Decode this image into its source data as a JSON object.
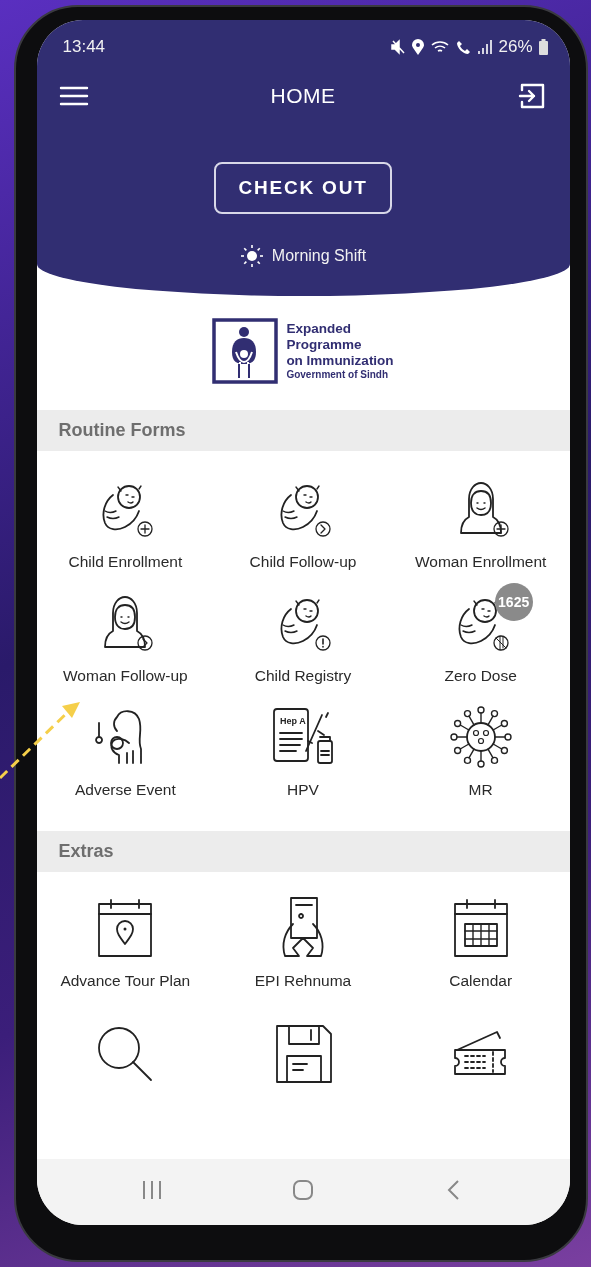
{
  "status_bar": {
    "time": "13:44",
    "battery": "26%"
  },
  "app_bar": {
    "title": "HOME"
  },
  "check_out_button": {
    "label": "CHECK OUT"
  },
  "shift": {
    "label": "Morning Shift"
  },
  "logo": {
    "lines": [
      "Expanded",
      "Programme",
      "on Immunization",
      "Government of Sindh"
    ]
  },
  "sections": [
    {
      "title": "Routine Forms",
      "tiles": [
        {
          "kind": "baby-plus",
          "label": "Child Enrollment"
        },
        {
          "kind": "baby-next",
          "label": "Child Follow-up"
        },
        {
          "kind": "woman-plus",
          "label": "Woman Enrollment"
        },
        {
          "kind": "woman-next",
          "label": "Woman Follow-up"
        },
        {
          "kind": "baby-alert",
          "label": "Child Registry"
        },
        {
          "kind": "baby-syringe",
          "label": "Zero Dose",
          "badge": "1625"
        },
        {
          "kind": "mother",
          "label": "Adverse Event"
        },
        {
          "kind": "document",
          "label": "HPV",
          "icon_text": "Hep A"
        },
        {
          "kind": "virus",
          "label": "MR"
        }
      ]
    },
    {
      "title": "Extras",
      "tiles": [
        {
          "kind": "calendar-pin",
          "label": "Advance Tour Plan"
        },
        {
          "kind": "hands-phone",
          "label": "EPI Rehnuma"
        },
        {
          "kind": "calendar",
          "label": "Calendar"
        },
        {
          "kind": "search"
        },
        {
          "kind": "floppy"
        },
        {
          "kind": "ticket"
        }
      ]
    }
  ]
}
